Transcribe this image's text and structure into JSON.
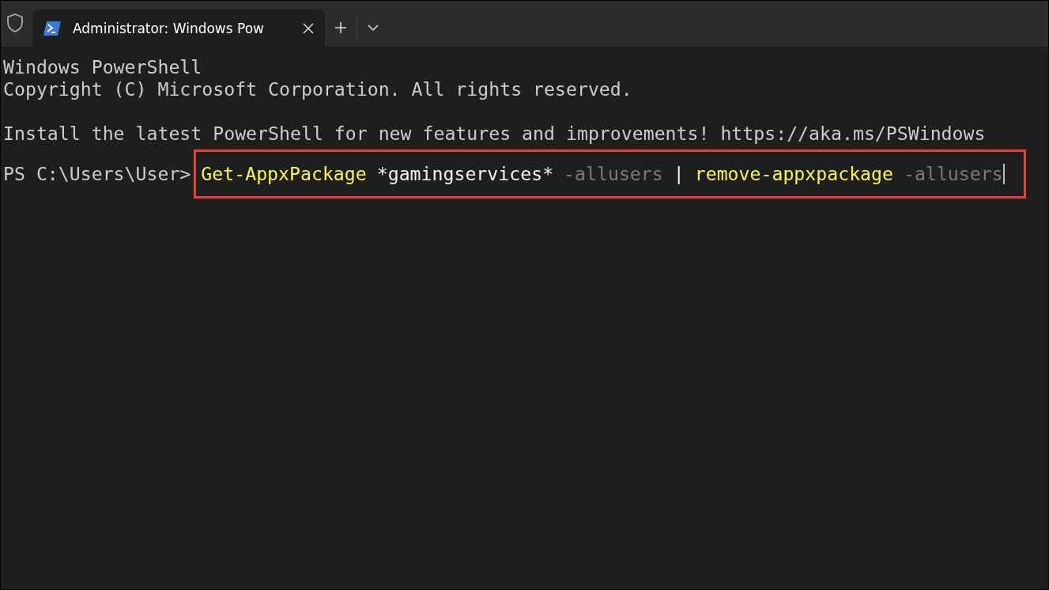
{
  "tab_bar": {
    "tabs": [
      {
        "title": "Administrator: Windows Pow",
        "selected": true
      }
    ]
  },
  "terminal": {
    "banner": [
      "Windows PowerShell",
      "Copyright (C) Microsoft Corporation. All rights reserved."
    ],
    "notice": "Install the latest PowerShell for new features and improvements! https://aka.ms/PSWindows",
    "prompt": "PS C:\\Users\\User>",
    "command": [
      {
        "kind": "command",
        "text": "Get-AppxPackage"
      },
      {
        "kind": "argument",
        "text": "*gamingservices*"
      },
      {
        "kind": "parameter",
        "text": "-allusers"
      },
      {
        "kind": "operator",
        "text": "|"
      },
      {
        "kind": "command",
        "text": "remove-appxpackage"
      },
      {
        "kind": "parameter",
        "text": "-allusers"
      }
    ]
  }
}
